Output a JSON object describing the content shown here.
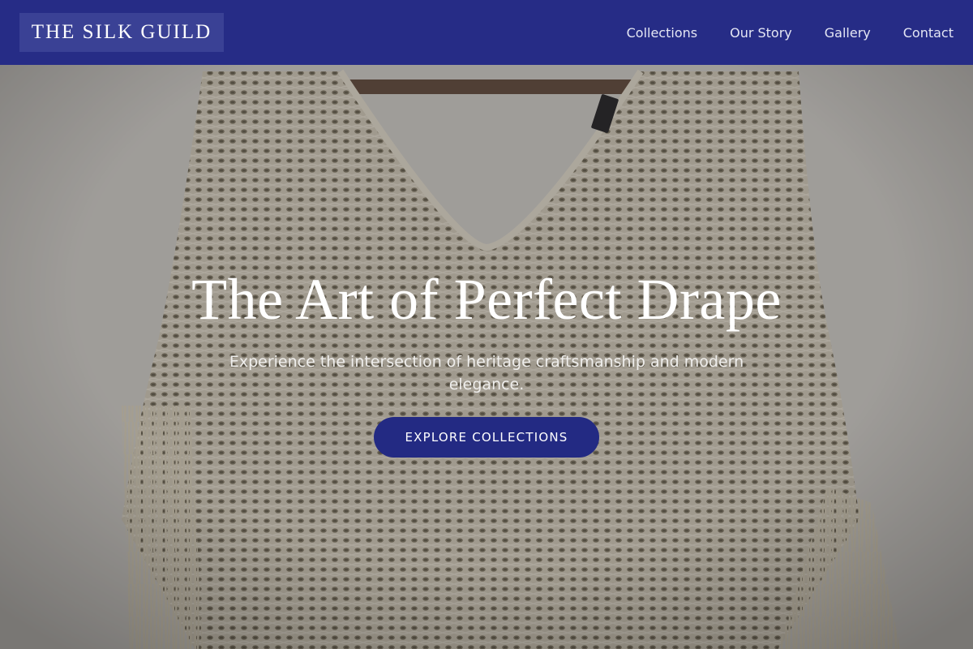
{
  "header": {
    "brand": "THE SILK GUILD",
    "nav": [
      {
        "label": "Collections"
      },
      {
        "label": "Our Story"
      },
      {
        "label": "Gallery"
      },
      {
        "label": "Contact"
      }
    ]
  },
  "hero": {
    "title": "The Art of Perfect Drape",
    "subtitle": "Experience the intersection of heritage craftsmanship and modern elegance.",
    "cta_label": "EXPLORE COLLECTIONS",
    "background_subject": "cream crochet knit poncho with fringe hanging on a wooden rod"
  },
  "colors": {
    "header_bg": "#262c86",
    "brand_bg": "#3a4195",
    "cta_bg": "#232a83",
    "wall": "#dcdad5",
    "knit": "#ddd6c4",
    "rod": "#6b5446"
  }
}
